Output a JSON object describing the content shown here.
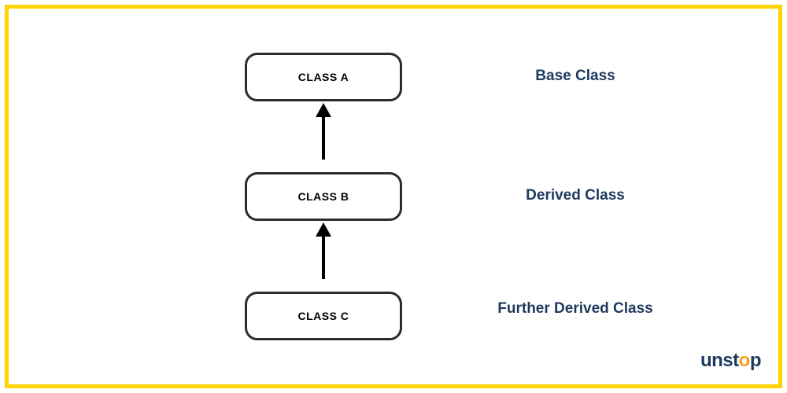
{
  "diagram": {
    "boxes": {
      "a": "CLASS A",
      "b": "CLASS B",
      "c": "CLASS C"
    },
    "labels": {
      "a": "Base Class",
      "b": "Derived Class",
      "c": "Further Derived Class"
    }
  },
  "branding": {
    "logo_prefix": "unst",
    "logo_accent": "o",
    "logo_suffix": "p"
  },
  "colors": {
    "border": "#ffd400",
    "box_border": "#2c2c2c",
    "label_text": "#1f3a5f",
    "accent": "#ff9e1b"
  }
}
